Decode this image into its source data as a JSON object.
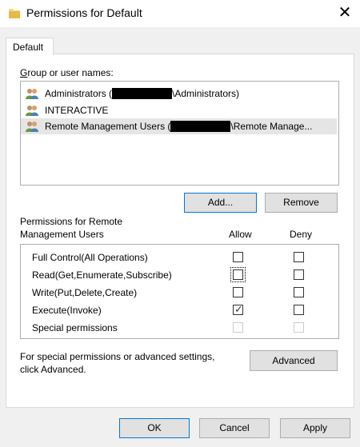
{
  "window": {
    "title": "Permissions for Default",
    "close_glyph": "✕",
    "icon": "folder-icon"
  },
  "tab": {
    "label": "Default"
  },
  "users": {
    "heading": "Group or user names:",
    "items": [
      {
        "prefix": "Administrators (",
        "suffix": "\\Administrators)",
        "icon": "users-icon"
      },
      {
        "prefix": "INTERACTIVE",
        "suffix": "",
        "icon": "users-icon"
      },
      {
        "prefix": "Remote Management Users (",
        "suffix": "\\Remote Manage...",
        "icon": "users-icon"
      }
    ]
  },
  "buttons": {
    "add": "Add...",
    "remove": "Remove",
    "advanced": "Advanced",
    "ok": "OK",
    "cancel": "Cancel",
    "apply": "Apply"
  },
  "permissions": {
    "heading_line1": "Permissions for Remote",
    "heading_line2": "Management Users",
    "allow_label": "Allow",
    "deny_label": "Deny",
    "rows": [
      {
        "label": "Full Control(All Operations)",
        "allow": false,
        "deny": false,
        "disabled": false
      },
      {
        "label": "Read(Get,Enumerate,Subscribe)",
        "allow": false,
        "deny": false,
        "disabled": false
      },
      {
        "label": "Write(Put,Delete,Create)",
        "allow": false,
        "deny": false,
        "disabled": false
      },
      {
        "label": "Execute(Invoke)",
        "allow": true,
        "deny": false,
        "disabled": false
      },
      {
        "label": "Special permissions",
        "allow": false,
        "deny": false,
        "disabled": true
      }
    ]
  },
  "advanced_note": {
    "line1": "For special permissions or advanced settings,",
    "line2": "click Advanced."
  },
  "colors": {
    "focus_border": "#0078d7",
    "selection": "#e5e5e5",
    "button_face": "#e1e1e1"
  }
}
